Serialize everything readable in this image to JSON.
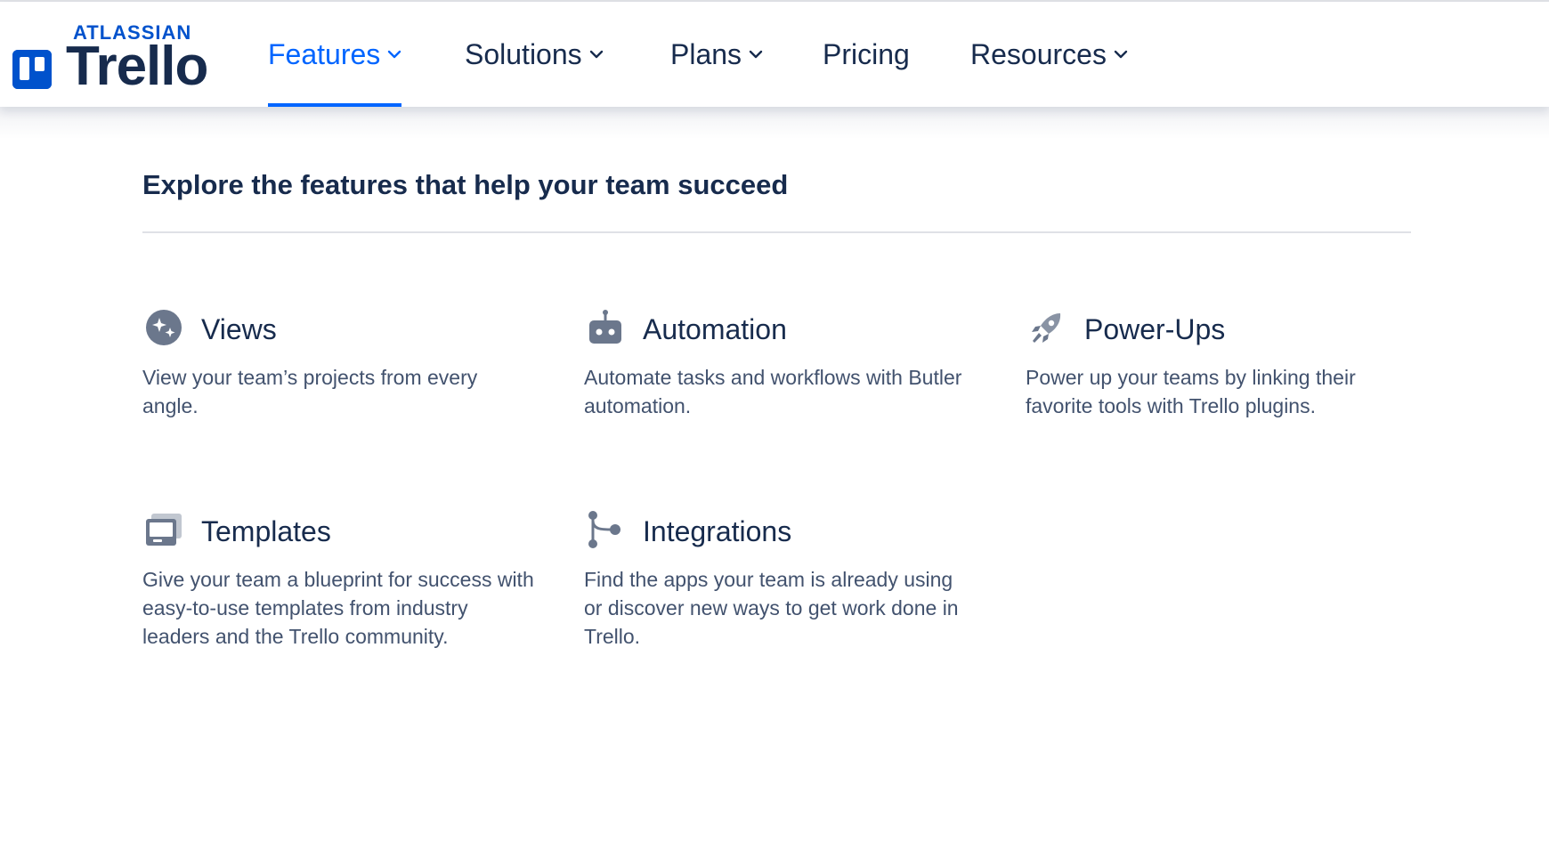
{
  "brand": {
    "atlassian": "ATLASSIAN",
    "product": "Trello"
  },
  "nav": {
    "items": [
      {
        "label": "Features",
        "active": true,
        "has_dropdown": true
      },
      {
        "label": "Solutions",
        "active": false,
        "has_dropdown": true
      },
      {
        "label": "Plans",
        "active": false,
        "has_dropdown": true
      },
      {
        "label": "Pricing",
        "active": false,
        "has_dropdown": false
      },
      {
        "label": "Resources",
        "active": false,
        "has_dropdown": true
      }
    ]
  },
  "features_menu": {
    "heading": "Explore the features that help your team succeed",
    "items": [
      {
        "icon": "views-icon",
        "title": "Views",
        "description": "View your team’s projects from every angle."
      },
      {
        "icon": "robot-icon",
        "title": "Automation",
        "description": "Automate tasks and workflows with Butler automation."
      },
      {
        "icon": "rocket-icon",
        "title": "Power-Ups",
        "description": "Power up your teams by linking their favorite tools with Trello plugins."
      },
      {
        "icon": "templates-icon",
        "title": "Templates",
        "description": "Give your team a blueprint for success with easy-to-use templates from industry leaders and the Trello community."
      },
      {
        "icon": "integrations-icon",
        "title": "Integrations",
        "description": "Find the apps your team is already using or discover new ways to get work done in Trello."
      }
    ]
  },
  "colors": {
    "brand_blue": "#0052cc",
    "active_blue": "#0065ff",
    "text_dark": "#172b4d",
    "text_muted": "#42526e",
    "icon_gray": "#6b778c"
  }
}
